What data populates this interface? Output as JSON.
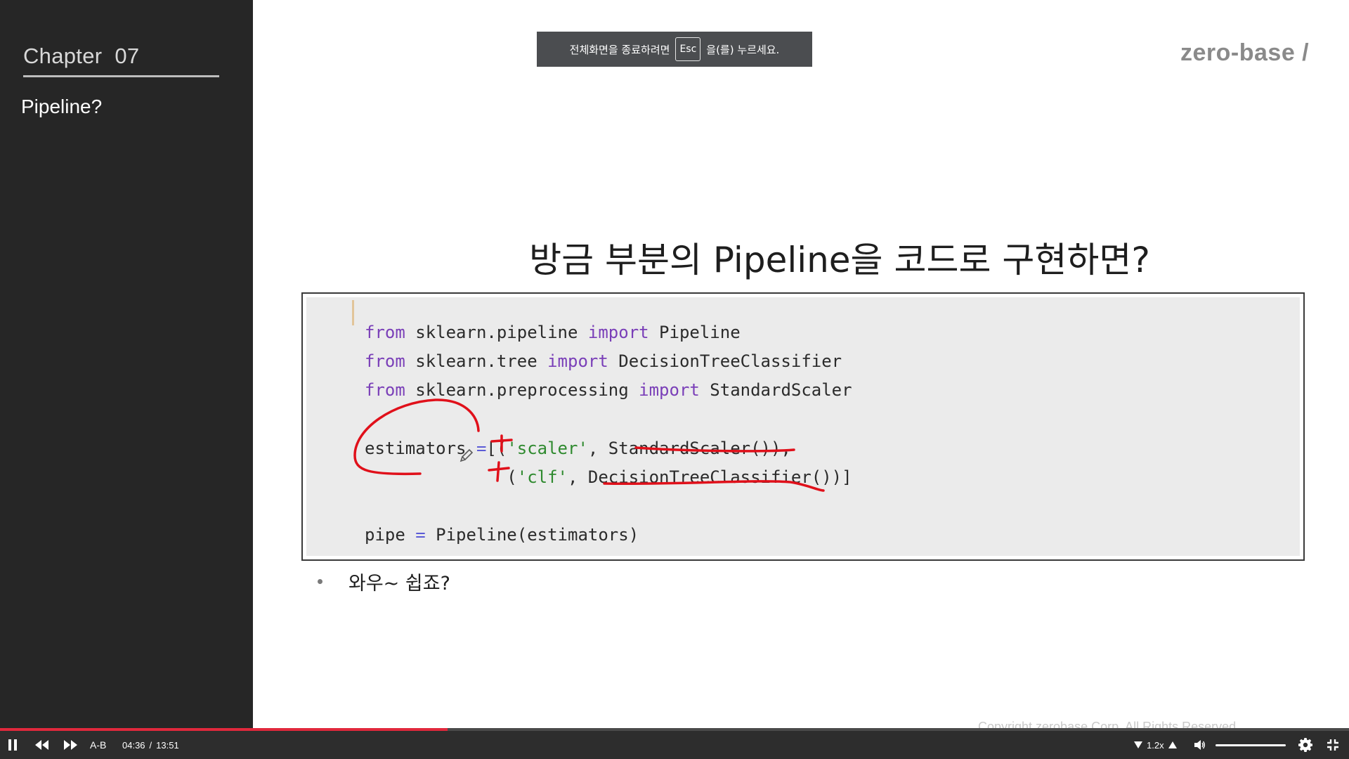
{
  "sidebar": {
    "chapter_label": "Chapter",
    "chapter_number": "07",
    "section_title": "Pipeline?"
  },
  "toast": {
    "prefix": "전체화면을 종료하려면",
    "key": "Esc",
    "suffix": "을(를) 누르세요."
  },
  "brand": {
    "logo": "zero-base /"
  },
  "slide": {
    "title": "방금 부분의 Pipeline을 코드로 구현하면?",
    "bullet": "와우~ 쉽죠?",
    "copyright": "Copyright zerobase Corp. All Rights Reserved."
  },
  "code": {
    "l1_kw1": "from",
    "l1_mod": " sklearn.pipeline ",
    "l1_kw2": "import",
    "l1_name": " Pipeline",
    "l2_kw1": "from",
    "l2_mod": " sklearn.tree ",
    "l2_kw2": "import",
    "l2_name": " DecisionTreeClassifier",
    "l3_kw1": "from",
    "l3_mod": " sklearn.preprocessing ",
    "l3_kw2": "import",
    "l3_name": " StandardScaler",
    "l5_a": "estimators ",
    "l5_op": "=",
    "l5_b": "[(",
    "l5_str": "'scaler'",
    "l5_c": ", StandardScaler()),",
    "l6_a": "              (",
    "l6_str": "'clf'",
    "l6_c": ", DecisionTreeClassifier())]",
    "l8_a": "pipe ",
    "l8_op": "=",
    "l8_b": " Pipeline(estimators)"
  },
  "player": {
    "progress_fraction": 0.332,
    "ab_label": "A-B",
    "current_time": "04:36",
    "separator": "/",
    "duration": "13:51",
    "speed": "1.2x",
    "volume_fraction": 1.0
  },
  "colors": {
    "accent_progress": "#e0283c",
    "annotation_red": "#e0101a",
    "sidebar_bg": "#262626"
  }
}
